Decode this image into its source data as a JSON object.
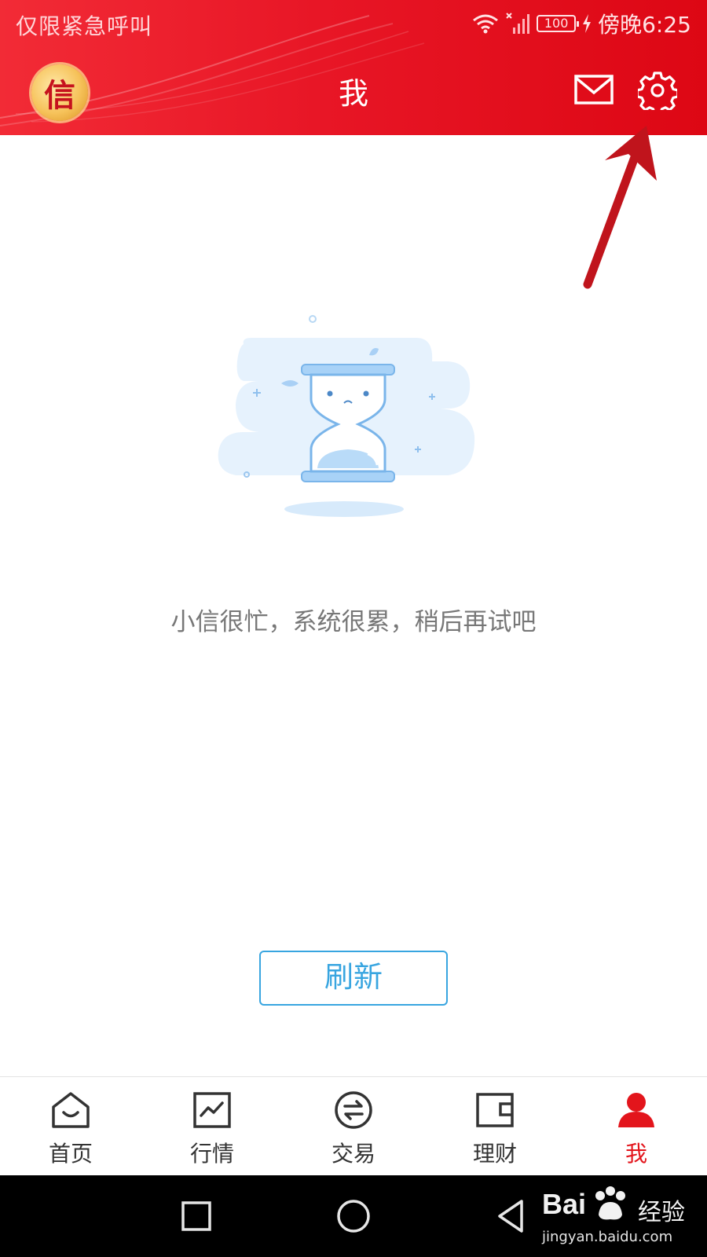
{
  "status_bar": {
    "carrier_text": "仅限紧急呼叫",
    "battery": "100",
    "time": "傍晚6:25"
  },
  "header": {
    "title": "我",
    "logo_text": "信",
    "icons": [
      "mail-icon",
      "settings-gear-icon"
    ]
  },
  "main": {
    "empty_message": "小信很忙，系统很累，稍后再试吧",
    "refresh_label": "刷新"
  },
  "tab_bar": {
    "items": [
      {
        "label": "首页",
        "icon": "home-icon",
        "active": false
      },
      {
        "label": "行情",
        "icon": "market-chart-icon",
        "active": false
      },
      {
        "label": "交易",
        "icon": "exchange-icon",
        "active": false
      },
      {
        "label": "理财",
        "icon": "wallet-icon",
        "active": false
      },
      {
        "label": "我",
        "icon": "person-icon",
        "active": true
      }
    ]
  },
  "system_nav": {
    "icons": [
      "recent-apps-icon",
      "home-circle-icon",
      "back-triangle-icon"
    ]
  },
  "watermark": {
    "brand": "Bai",
    "brand_suffix": "经验",
    "url": "jingyan.baidu.com"
  },
  "colors": {
    "header_red": "#e81626",
    "active_tab_red": "#e3151c",
    "refresh_blue": "#38a5e0",
    "annotation_arrow": "#c0141c"
  }
}
